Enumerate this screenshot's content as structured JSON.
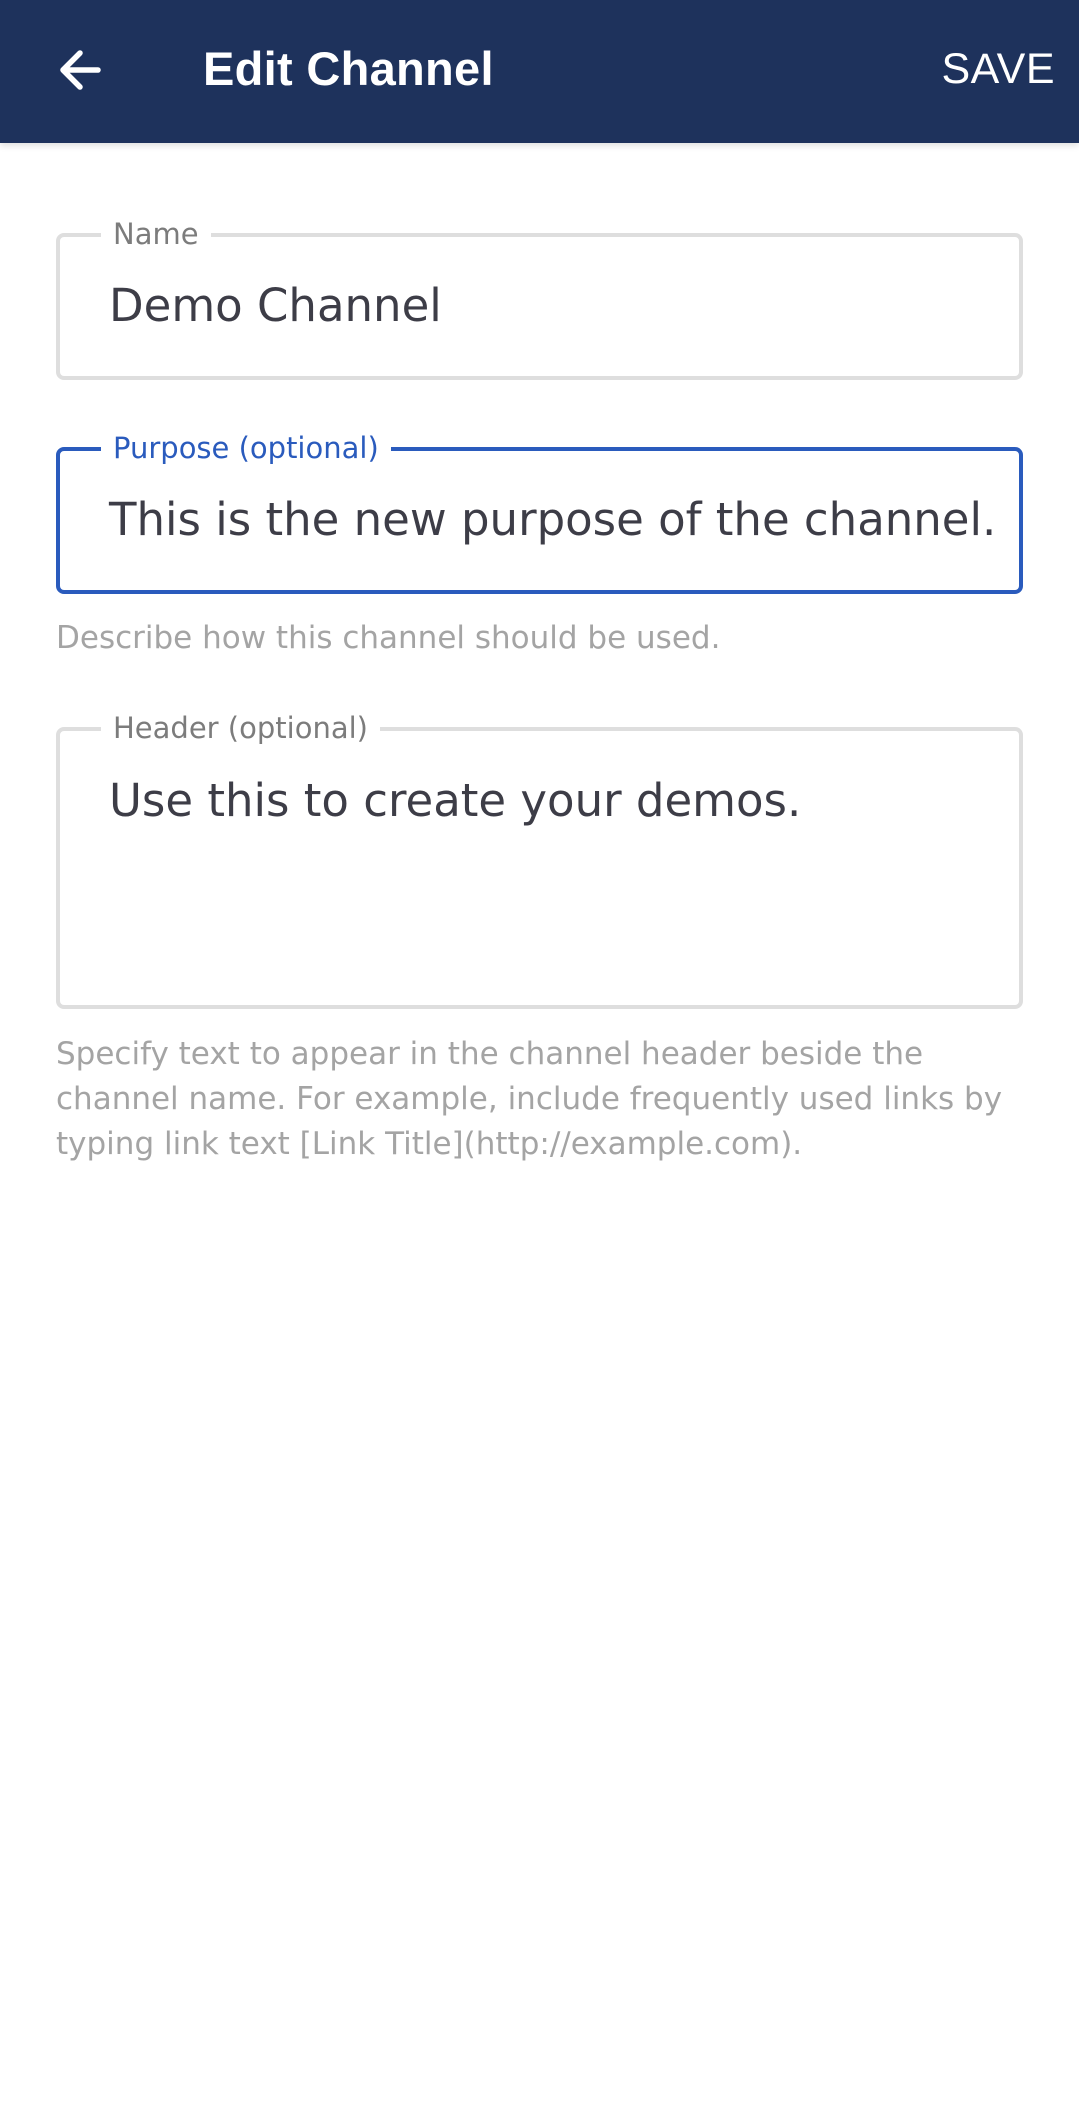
{
  "header": {
    "title": "Edit Channel",
    "save_label": "SAVE",
    "back_icon": "arrow-left-icon",
    "background": "#1e325c"
  },
  "form": {
    "name": {
      "label": "Name",
      "value": "Demo Channel"
    },
    "purpose": {
      "label": "Purpose (optional)",
      "value": "This is the new purpose of the channel.",
      "hint": "Describe how this channel should be used.",
      "focused": true,
      "accent": "#2a5bbd"
    },
    "header_field": {
      "label": "Header (optional)",
      "value": "Use this to create your demos.",
      "hint": "Specify text to appear in the channel header beside the channel name. For example, include frequently used links by typing link text [Link Title](http://example.com)."
    }
  }
}
